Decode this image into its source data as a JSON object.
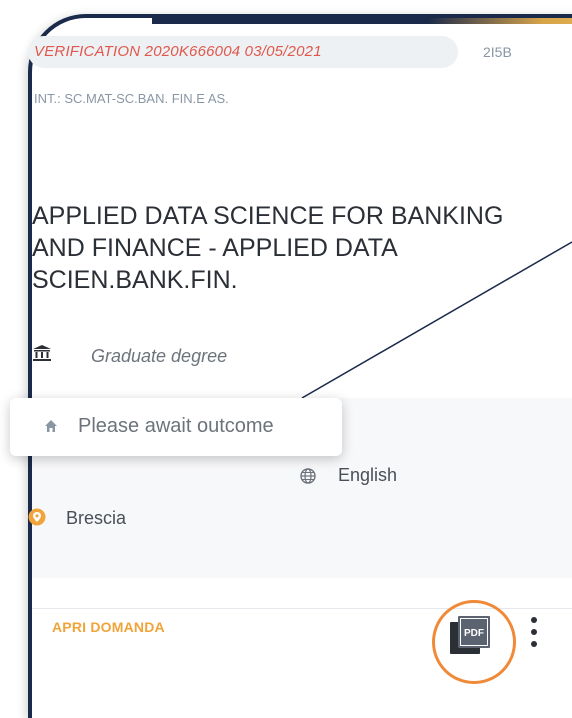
{
  "header": {
    "verification": "VERIFICATION  2020K666004  03/05/2021",
    "code": "2I5B",
    "interclass": "INT.: SC.MAT-SC.BAN. FIN.E AS."
  },
  "course": {
    "title": "APPLIED DATA SCIENCE FOR BANKING AND FINANCE - APPLIED DATA SCIEN.BANK.FIN.",
    "degree": "Graduate  degree",
    "language": "English",
    "city": "Brescia"
  },
  "popover": {
    "status": "Please await outcome"
  },
  "footer": {
    "apri_label": "APRI DOMANDA",
    "pdf_label": "PDF"
  },
  "icons": {
    "degree": "bank-icon",
    "language": "globe-icon",
    "city": "map-pin-icon",
    "status": "home-icon",
    "pdf": "pdf-icon",
    "more": "more-vert-icon"
  },
  "colors": {
    "verification": "#e0584c",
    "accent": "#f0a43a",
    "highlight_ring": "#f08a38",
    "frame": "#1b2a4a"
  }
}
